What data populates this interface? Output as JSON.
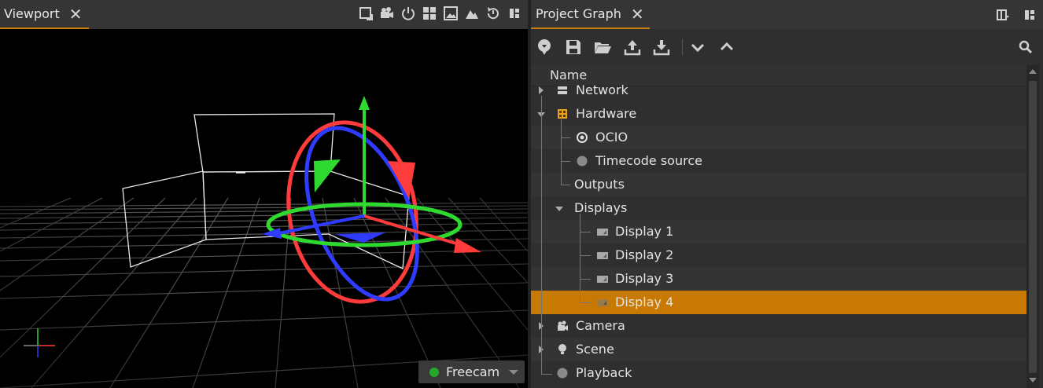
{
  "viewport": {
    "tab_label": "Viewport",
    "toolbar_icons": [
      "maximize-icon",
      "camera-icon",
      "power-icon",
      "grid-icon",
      "image-icon",
      "terrain-icon",
      "rotate-icon",
      "layout-icon"
    ],
    "freecam_label": "Freecam",
    "freecam_status_color": "#25a82a"
  },
  "project_graph": {
    "tab_label": "Project Graph",
    "toolbar_icons": [
      "import-icon",
      "save-icon",
      "open-folder-icon",
      "upload-icon",
      "download-icon",
      "expand-all-icon",
      "collapse-all-icon",
      "search-icon"
    ],
    "column_header": "Name",
    "tree": [
      {
        "label": "Network",
        "icon": "network-icon",
        "expand": "collapsed"
      },
      {
        "label": "Hardware",
        "icon": "hardware-icon",
        "expand": "expanded"
      },
      {
        "label": "OCIO",
        "icon": "ocio-icon"
      },
      {
        "label": "Timecode source",
        "icon": "timecode-icon"
      },
      {
        "label": "Outputs"
      },
      {
        "label": "Displays",
        "expand": "expanded"
      },
      {
        "label": "Display 1",
        "icon": "display-icon"
      },
      {
        "label": "Display 2",
        "icon": "display-icon"
      },
      {
        "label": "Display 3",
        "icon": "display-icon"
      },
      {
        "label": "Display 4",
        "icon": "display-icon",
        "selected": true
      },
      {
        "label": "Camera",
        "icon": "camera-icon",
        "expand": "collapsed"
      },
      {
        "label": "Scene",
        "icon": "light-bulb-icon",
        "expand": "collapsed"
      },
      {
        "label": "Playback",
        "icon": "playback-icon"
      }
    ]
  },
  "colors": {
    "accent": "#c87904",
    "gizmo_x": "#ff3b3b",
    "gizmo_y": "#2fd92f",
    "gizmo_z": "#2f3bff"
  }
}
